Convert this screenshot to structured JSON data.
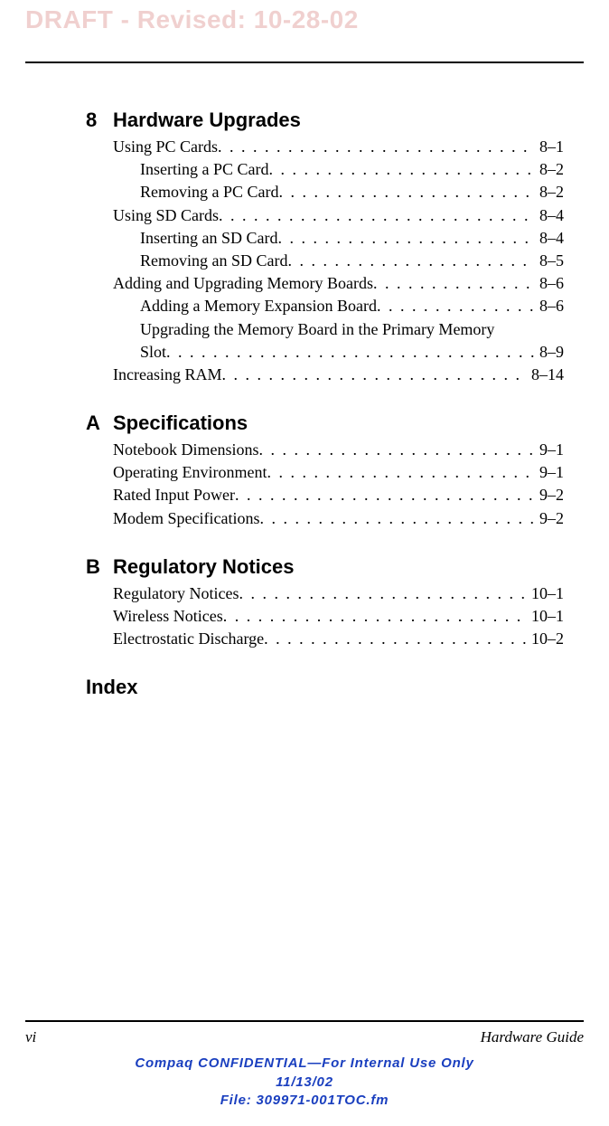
{
  "draft_header": "DRAFT - Revised: 10-28-02",
  "sections": [
    {
      "num": "8",
      "title": "Hardware Upgrades",
      "entries": [
        {
          "lvl": 1,
          "text": "Using PC Cards",
          "page": "8–1"
        },
        {
          "lvl": 2,
          "text": "Inserting a PC Card",
          "page": "8–2"
        },
        {
          "lvl": 2,
          "text": "Removing a PC Card",
          "page": "8–2"
        },
        {
          "lvl": 1,
          "text": "Using SD Cards",
          "page": "8–4"
        },
        {
          "lvl": 2,
          "text": "Inserting an SD Card",
          "page": "8–4"
        },
        {
          "lvl": 2,
          "text": "Removing an SD Card",
          "page": "8–5"
        },
        {
          "lvl": 1,
          "text": "Adding and Upgrading Memory Boards",
          "page": "8–6"
        },
        {
          "lvl": 2,
          "text": "Adding a Memory Expansion Board",
          "page": "8–6"
        },
        {
          "lvl": 2,
          "wrap": true,
          "text": "Upgrading the Memory Board in the Primary Memory",
          "cont": "Slot",
          "page": "8–9"
        },
        {
          "lvl": 1,
          "text": "Increasing RAM",
          "page": "8–14"
        }
      ]
    },
    {
      "num": "A",
      "title": "Specifications",
      "entries": [
        {
          "lvl": 1,
          "text": "Notebook Dimensions",
          "page": "9–1"
        },
        {
          "lvl": 1,
          "text": "Operating Environment",
          "page": "9–1"
        },
        {
          "lvl": 1,
          "text": "Rated Input Power",
          "page": "9–2"
        },
        {
          "lvl": 1,
          "text": "Modem Specifications",
          "page": "9–2"
        }
      ]
    },
    {
      "num": "B",
      "title": "Regulatory Notices",
      "entries": [
        {
          "lvl": 1,
          "text": "Regulatory Notices",
          "page": "10–1"
        },
        {
          "lvl": 1,
          "text": "Wireless Notices",
          "page": "10–1"
        },
        {
          "lvl": 1,
          "text": "Electrostatic Discharge",
          "page": "10–2"
        }
      ]
    }
  ],
  "index_label": "Index",
  "footer": {
    "page": "vi",
    "title": "Hardware Guide"
  },
  "confidential": {
    "line1": "Compaq CONFIDENTIAL—For Internal Use Only",
    "line2": "11/13/02",
    "line3": "File: 309971-001TOC.fm"
  }
}
